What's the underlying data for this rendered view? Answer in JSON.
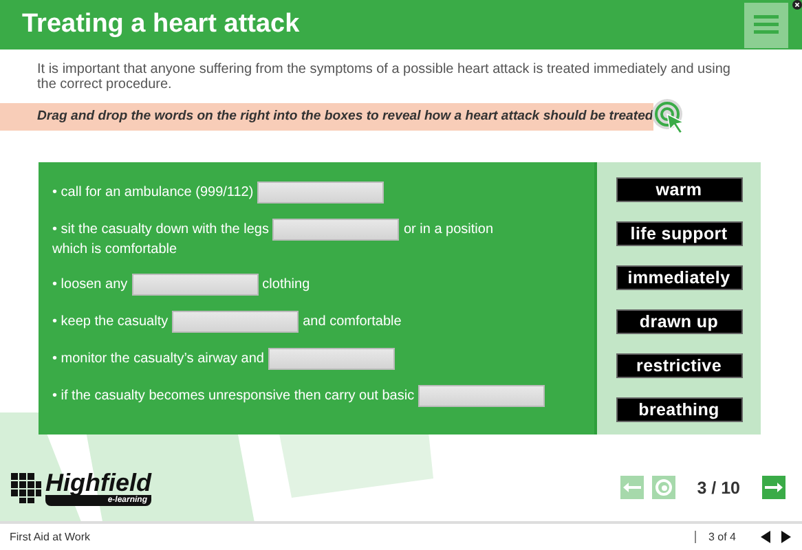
{
  "header": {
    "title": "Treating a heart attack"
  },
  "intro": "It is important that anyone suffering from the symptoms of a possible heart attack is treated immediately and using the correct procedure.",
  "instruction": "Drag and drop the words on the right into the boxes to reveal how a heart attack should be treated",
  "sentences": [
    {
      "before": "• call for an ambulance (999/112)"
    },
    {
      "before": "• sit the casualty down with the legs",
      "after": "or in a position",
      "continuation": "which is comfortable"
    },
    {
      "before": "• loosen any",
      "after": "clothing"
    },
    {
      "before": "• keep the casualty",
      "after": "and comfortable"
    },
    {
      "before": "• monitor the casualty’s airway and"
    },
    {
      "before": "• if the casualty becomes unresponsive then carry out basic"
    }
  ],
  "words": [
    "warm",
    "life support",
    "immediately",
    "drawn up",
    "restrictive",
    "breathing"
  ],
  "logo": {
    "name": "Highfield",
    "tagline": "e-learning"
  },
  "pager": {
    "reading": "3 / 10"
  },
  "status_bar": {
    "course": "First Aid at Work",
    "page": "3 of 4"
  }
}
